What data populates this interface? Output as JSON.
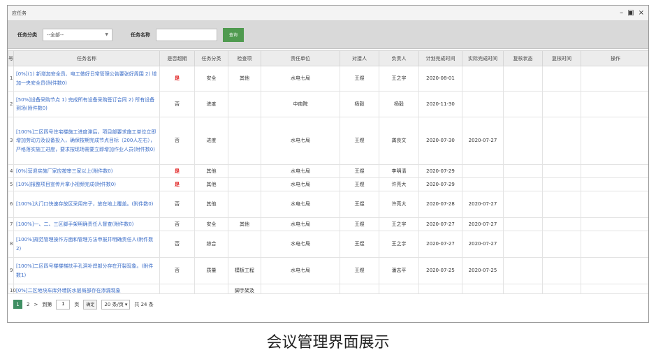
{
  "window": {
    "title": "应任务",
    "min": "–",
    "max": "▣",
    "close": "×"
  },
  "filters": {
    "category_label": "任务分类",
    "category_value": "--全部--",
    "name_label": "任务名称",
    "name_value": "",
    "query_label": "查询"
  },
  "columns": [
    "号",
    "任务名称",
    "是否超期",
    "任务分类",
    "检查项",
    "责任单位",
    "对接人",
    "负责人",
    "计划完成时间",
    "实际完成时间",
    "复核状态",
    "复核时间",
    "操作"
  ],
  "rows": [
    {
      "idx": "1",
      "name": "[0%](1) 新增加安全员、电工做好日常管理公告要张好周围 2) 增加一央安全员(附件数0)",
      "overdue": "是",
      "category": "安全",
      "check": "其他",
      "unit": "水电七局",
      "contact": "王煜",
      "owner": "王之宇",
      "plan": "2020-08-01",
      "actual": "",
      "review": "",
      "review_time": "",
      "op": ""
    },
    {
      "idx": "2",
      "name": "[50%]设备采购节点 1) 完成所有设备采购签订合同 2) 所有设备到场(附件数0)",
      "overdue": "否",
      "category": "进度",
      "check": "",
      "unit": "中南院",
      "contact": "杨毅",
      "owner": "杨毅",
      "plan": "2020-11-30",
      "actual": "",
      "review": "",
      "review_time": "",
      "op": ""
    },
    {
      "idx": "3",
      "name": "[100%]二区四号住宅楼施工进度滞后，项目部要求施工单位立即增加劳动力及设备投入，确保按期完成节点目标（200人左右），严格落实施工进度，要求按现场需要立即增加作业人员(附件数0)",
      "overdue": "否",
      "category": "进度",
      "check": "",
      "unit": "水电七局",
      "contact": "王煜",
      "owner": "龚良文",
      "plan": "2020-07-30",
      "actual": "2020-07-27",
      "review": "",
      "review_time": "",
      "op": ""
    },
    {
      "idx": "4",
      "name": "[0%]营退实施厂家应按审三家以上(附件数0)",
      "overdue": "是",
      "category": "其他",
      "check": "",
      "unit": "水电七局",
      "contact": "王煜",
      "owner": "李明清",
      "plan": "2020-07-29",
      "actual": "",
      "review": "",
      "review_time": "",
      "op": ""
    },
    {
      "idx": "5",
      "name": "[10%]报整项目宣传片拿小视频完成(附件数0)",
      "overdue": "是",
      "category": "其他",
      "check": "",
      "unit": "水电七局",
      "contact": "王煜",
      "owner": "许亮大",
      "plan": "2020-07-29",
      "actual": "",
      "review": "",
      "review_time": "",
      "op": ""
    },
    {
      "idx": "6",
      "name": "[100%]大门口快速存放区采用帘子，放在地上覆盖。(附件数0)",
      "overdue": "否",
      "category": "其他",
      "check": "",
      "unit": "水电七局",
      "contact": "王煜",
      "owner": "许亮大",
      "plan": "2020-07-28",
      "actual": "2020-07-27",
      "review": "",
      "review_time": "",
      "op": ""
    },
    {
      "idx": "7",
      "name": "[100%]一、二、三区脚手架明确责任人督查(附件数0)",
      "overdue": "否",
      "category": "安全",
      "check": "其他",
      "unit": "水电七局",
      "contact": "王煜",
      "owner": "王之宇",
      "plan": "2020-07-27",
      "actual": "2020-07-27",
      "review": "",
      "review_time": "",
      "op": ""
    },
    {
      "idx": "8",
      "name": "[100%]规范管理操作方面和管理方法申报并明确责任人(附件数2)",
      "overdue": "否",
      "category": "综合",
      "check": "",
      "unit": "水电七局",
      "contact": "王煜",
      "owner": "王之宇",
      "plan": "2020-07-27",
      "actual": "2020-07-27",
      "review": "",
      "review_time": "",
      "op": ""
    },
    {
      "idx": "9",
      "name": "[100%]二区四号楼楼梯扶手孔洞补焊部分存在开裂现象。(附件数1)",
      "overdue": "否",
      "category": "质量",
      "check": "模板工程",
      "unit": "水电七局",
      "contact": "王煜",
      "owner": "潘志平",
      "plan": "2020-07-25",
      "actual": "2020-07-25",
      "review": "",
      "review_time": "",
      "op": ""
    },
    {
      "idx": "10",
      "name": "[0%]二区地块车库外墙防水层局部存在渗漏现象",
      "overdue": "",
      "category": "",
      "check": "脚手架及",
      "unit": "",
      "contact": "",
      "owner": "",
      "plan": "",
      "actual": "",
      "review": "",
      "review_time": "",
      "op": ""
    }
  ],
  "pager": {
    "current": "1",
    "next": "2",
    "arrow": ">",
    "goto_label": "到第",
    "page_value": "1",
    "page_suffix": "页",
    "confirm": "确定",
    "per_page": "20 条/页",
    "total": "共 24 条"
  },
  "caption": "会议管理界面展示"
}
